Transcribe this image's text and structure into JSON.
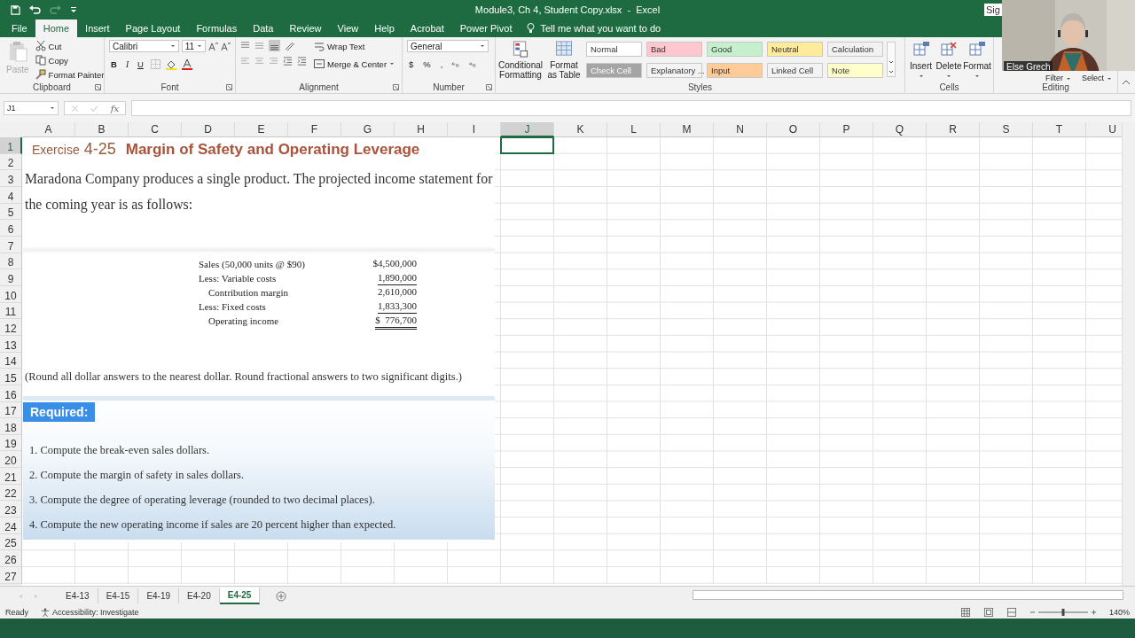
{
  "title_bar": {
    "title": "Module3, Ch 4, Student Copy.xlsx  -  Excel",
    "sign_in": "Sig"
  },
  "ribbon_tabs": [
    {
      "label": "File",
      "selected": false
    },
    {
      "label": "Home",
      "selected": true
    },
    {
      "label": "Insert",
      "selected": false
    },
    {
      "label": "Page Layout",
      "selected": false
    },
    {
      "label": "Formulas",
      "selected": false
    },
    {
      "label": "Data",
      "selected": false
    },
    {
      "label": "Review",
      "selected": false
    },
    {
      "label": "View",
      "selected": false
    },
    {
      "label": "Help",
      "selected": false
    },
    {
      "label": "Acrobat",
      "selected": false
    },
    {
      "label": "Power Pivot",
      "selected": false
    }
  ],
  "tell_me": "Tell me what you want to do",
  "clipboard": {
    "paste": {
      "label": "Paste",
      "disabled": true
    },
    "items": [
      "Cut",
      "Copy",
      "Format Painter"
    ],
    "label": "Clipboard"
  },
  "font": {
    "name": "Calibri",
    "size": "11",
    "buttons": [
      "B",
      "I",
      "U"
    ],
    "label": "Font"
  },
  "alignment": {
    "wrap": "Wrap Text",
    "merge": "Merge & Center",
    "label": "Alignment"
  },
  "number": {
    "format": "General",
    "symbols": [
      "$",
      "%",
      ","
    ],
    "label": "Number"
  },
  "styles": {
    "conditional": "Conditional Formatting",
    "format_table": "Format as Table",
    "label": "Styles",
    "cells": [
      {
        "label": "Normal",
        "color": "#ffffff"
      },
      {
        "label": "Bad",
        "color": "#ffc7ce"
      },
      {
        "label": "Good",
        "color": "#c6efce"
      },
      {
        "label": "Neutral",
        "color": "#ffeb9c"
      },
      {
        "label": "Calculation",
        "color": "#f2f2f2"
      },
      {
        "label": "Check Cell",
        "color": "#a5a5a5"
      },
      {
        "label": "Explanatory ...",
        "color": "#f3f3f3"
      },
      {
        "label": "Input",
        "color": "#ffcc99"
      },
      {
        "label": "Linked Cell",
        "color": "#f3f3f3"
      },
      {
        "label": "Note",
        "color": "#ffffcc"
      }
    ]
  },
  "cells": {
    "buttons": [
      "Insert",
      "Delete",
      "Format"
    ],
    "label": "Cells"
  },
  "editing": {
    "buttons": [
      "Filter",
      "Select"
    ],
    "label": "Editing"
  },
  "formula_bar": {
    "name_box": "J1",
    "fx": "fx"
  },
  "grid": {
    "columns": [
      {
        "label": "A",
        "selected": false
      },
      {
        "label": "B",
        "selected": false
      },
      {
        "label": "C",
        "selected": false
      },
      {
        "label": "D",
        "selected": false
      },
      {
        "label": "E",
        "selected": false
      },
      {
        "label": "F",
        "selected": false
      },
      {
        "label": "G",
        "selected": false
      },
      {
        "label": "H",
        "selected": false
      },
      {
        "label": "I",
        "selected": false
      },
      {
        "label": "J",
        "selected": true
      },
      {
        "label": "K",
        "selected": false
      },
      {
        "label": "L",
        "selected": false
      },
      {
        "label": "M",
        "selected": false
      },
      {
        "label": "N",
        "selected": false
      },
      {
        "label": "O",
        "selected": false
      },
      {
        "label": "P",
        "selected": false
      },
      {
        "label": "Q",
        "selected": false
      },
      {
        "label": "R",
        "selected": false
      },
      {
        "label": "S",
        "selected": false
      },
      {
        "label": "T",
        "selected": false
      },
      {
        "label": "U",
        "selected": false
      }
    ],
    "rows": [
      {
        "label": "1",
        "selected": true
      },
      {
        "label": "2",
        "selected": false
      },
      {
        "label": "3",
        "selected": false
      },
      {
        "label": "4",
        "selected": false
      },
      {
        "label": "5",
        "selected": false
      },
      {
        "label": "6",
        "selected": false
      },
      {
        "label": "7",
        "selected": false
      },
      {
        "label": "8",
        "selected": false
      },
      {
        "label": "9",
        "selected": false
      },
      {
        "label": "10",
        "selected": false
      },
      {
        "label": "11",
        "selected": false
      },
      {
        "label": "12",
        "selected": false
      },
      {
        "label": "13",
        "selected": false
      },
      {
        "label": "14",
        "selected": false
      },
      {
        "label": "15",
        "selected": false
      },
      {
        "label": "16",
        "selected": false
      },
      {
        "label": "17",
        "selected": false
      },
      {
        "label": "18",
        "selected": false
      },
      {
        "label": "19",
        "selected": false
      },
      {
        "label": "20",
        "selected": false
      },
      {
        "label": "21",
        "selected": false
      },
      {
        "label": "22",
        "selected": false
      },
      {
        "label": "23",
        "selected": false
      },
      {
        "label": "24",
        "selected": false
      },
      {
        "label": "25",
        "selected": false
      },
      {
        "label": "26",
        "selected": false
      },
      {
        "label": "27",
        "selected": false
      }
    ]
  },
  "exercise": {
    "prefix": "Exercise",
    "number": "4-25",
    "title": "Margin of Safety and Operating Leverage",
    "intro": "Maradona Company produces a single product. The projected income statement for the coming year is as follows:",
    "statement": [
      {
        "label": "Sales (50,000 units @ $90)",
        "amount": "$4,500,000",
        "indent": false,
        "underlined": false,
        "double_underlined": false
      },
      {
        "label": "Less: Variable costs",
        "amount": "1,890,000",
        "indent": false,
        "underlined": true,
        "double_underlined": false
      },
      {
        "label": "Contribution margin",
        "amount": "2,610,000",
        "indent": true,
        "underlined": false,
        "double_underlined": false
      },
      {
        "label": "Less: Fixed costs",
        "amount": "1,833,300",
        "indent": false,
        "underlined": true,
        "double_underlined": false
      },
      {
        "label": "Operating income",
        "amount": "$  776,700",
        "indent": true,
        "underlined": false,
        "double_underlined": true
      }
    ],
    "note": "(Round all dollar answers to the nearest dollar. Round fractional answers to two significant digits.)",
    "required": "Required:",
    "tasks": [
      "1. Compute the break-even sales dollars.",
      "2. Compute the margin of safety in sales dollars.",
      "3. Compute the degree of operating leverage (rounded to two decimal places).",
      "4. Compute the new operating income if sales are 20 percent higher than expected."
    ]
  },
  "sheet_tabs": [
    {
      "label": "E4-13",
      "selected": false
    },
    {
      "label": "E4-15",
      "selected": false
    },
    {
      "label": "E4-19",
      "selected": false
    },
    {
      "label": "E4-20",
      "selected": false
    },
    {
      "label": "E4-25",
      "selected": true
    }
  ],
  "status_bar": {
    "ready": "Ready",
    "accessibility": "Accessibility: Investigate",
    "zoom": "140%",
    "zoom_slider": {
      "level": 0.5
    }
  },
  "webcam": {
    "kind": "picture",
    "name": "Else Grech"
  }
}
